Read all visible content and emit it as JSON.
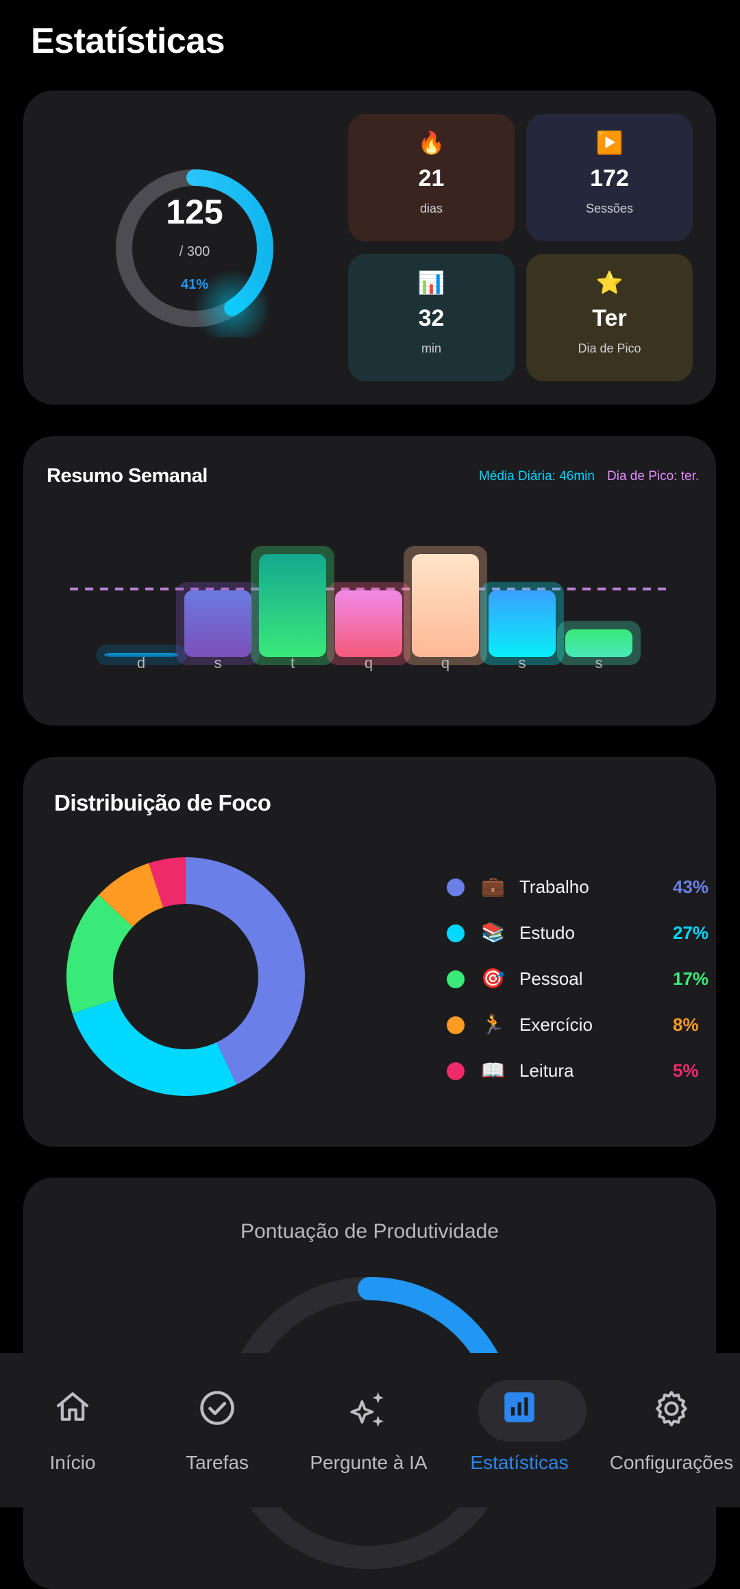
{
  "page": {
    "title": "Estatísticas"
  },
  "overview": {
    "ring": {
      "value": "125",
      "total": "/ 300",
      "percent": "41%",
      "progress": 0.41
    },
    "tiles": [
      {
        "icon": "🔥",
        "icon_name": "fire-icon",
        "value": "21",
        "label": "dias",
        "bg": "#3a2420"
      },
      {
        "icon": "▶️",
        "icon_name": "play-icon",
        "value": "172",
        "label": "Sessões",
        "bg": "#24283a"
      },
      {
        "icon": "📊",
        "icon_name": "bar-chart-icon",
        "value": "32",
        "label": "min",
        "bg": "#1d3237"
      },
      {
        "icon": "⭐",
        "icon_name": "star-icon",
        "value": "Ter",
        "label": "Dia de Pico",
        "bg": "#3a3320"
      }
    ]
  },
  "weekly": {
    "title": "Resumo Semanal",
    "avg": "Média Diária: 46min",
    "peak": "Dia de Pico: ter.",
    "chart_data": {
      "type": "bar",
      "categories": [
        "d",
        "s",
        "t",
        "q",
        "q",
        "s",
        "s"
      ],
      "values": [
        2,
        48,
        74,
        48,
        74,
        48,
        20
      ],
      "average": 46,
      "colors": [
        [
          "#0a9ad6",
          "#0a6aa0"
        ],
        [
          "#6a7ae0",
          "#7b4fb8"
        ],
        [
          "#14a890",
          "#3ae87a"
        ],
        [
          "#f08ae8",
          "#f55a7a"
        ],
        [
          "#ffe4c8",
          "#ffb896"
        ],
        [
          "#3aa0ff",
          "#08eef8"
        ],
        [
          "#3ae87a",
          "#48e8b8"
        ]
      ]
    }
  },
  "focus": {
    "title": "Distribuição de Foco",
    "chart_data": {
      "type": "pie",
      "categories": [
        "Trabalho",
        "Estudo",
        "Pessoal",
        "Exercício",
        "Leitura"
      ],
      "values": [
        43,
        27,
        17,
        8,
        5
      ],
      "colors": [
        "#6a7fe8",
        "#00d8ff",
        "#3aea78",
        "#ff9a22",
        "#ef2a6a"
      ]
    },
    "legend": [
      {
        "emoji": "💼",
        "name": "Trabalho",
        "pct": "43%",
        "color": "#6a7fe8"
      },
      {
        "emoji": "📚",
        "name": "Estudo",
        "pct": "27%",
        "color": "#00d8ff"
      },
      {
        "emoji": "🎯",
        "name": "Pessoal",
        "pct": "17%",
        "color": "#3aea78"
      },
      {
        "emoji": "🏃",
        "name": "Exercício",
        "pct": "8%",
        "color": "#ff9a22"
      },
      {
        "emoji": "📖",
        "name": "Leitura",
        "pct": "5%",
        "color": "#ef2a6a"
      }
    ]
  },
  "score": {
    "title": "Pontuação de Produtividade"
  },
  "nav": {
    "items": [
      {
        "label": "Início",
        "icon": "home-icon",
        "active": false
      },
      {
        "label": "Tarefas",
        "icon": "check-circle-icon",
        "active": false
      },
      {
        "label": "Pergunte à IA",
        "icon": "sparkles-icon",
        "active": false
      },
      {
        "label": "Estatísticas",
        "icon": "stats-icon",
        "active": true
      },
      {
        "label": "Configurações",
        "icon": "gear-icon",
        "active": false
      }
    ],
    "active_color": "#2b86f0"
  }
}
